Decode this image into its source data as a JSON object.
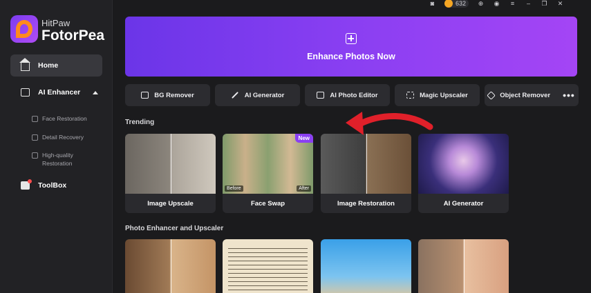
{
  "brand": {
    "top": "HitPaw",
    "main": "FotorPea"
  },
  "sidebar": {
    "home": "Home",
    "ai_enhancer": "AI Enhancer",
    "sub_items": [
      "Face Restoration",
      "Detail Recovery",
      "High-quality Restoration"
    ],
    "toolbox": "ToolBox"
  },
  "topbar": {
    "coins": "632"
  },
  "hero": {
    "title": "Enhance Photos Now"
  },
  "tools": [
    "BG Remover",
    "AI Generator",
    "AI Photo Editor",
    "Magic Upscaler",
    "Object Remover"
  ],
  "sections": {
    "trending": "Trending",
    "photo_enhancer": "Photo Enhancer and Upscaler"
  },
  "trending_cards": [
    {
      "label": "Image Upscale"
    },
    {
      "label": "Face Swap",
      "badge": "New",
      "before": "Before",
      "after": "After"
    },
    {
      "label": "Image Restoration"
    },
    {
      "label": "AI Generator"
    }
  ],
  "colors": {
    "accent": "#8a3ff2",
    "sidebar_bg": "#222225",
    "main_bg": "#1b1b1d",
    "arrow": "#e0202a"
  }
}
